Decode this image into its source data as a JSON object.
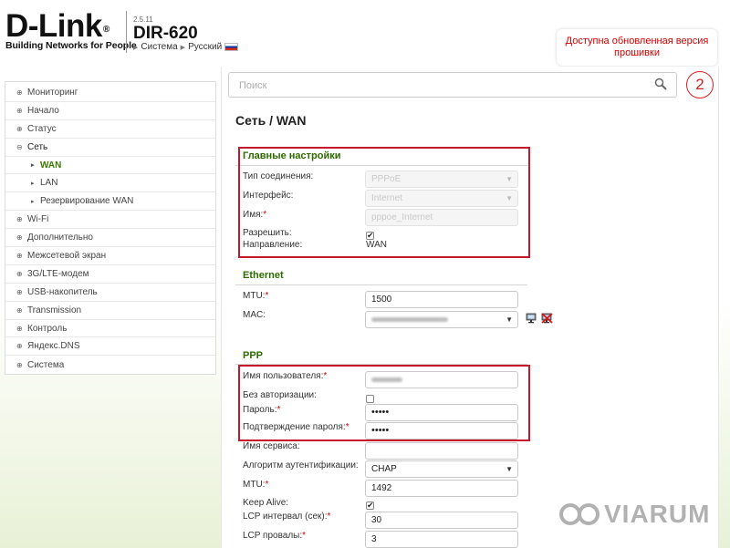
{
  "header": {
    "logo_text": "D-Link",
    "logo_tagline": "Building Networks for People",
    "firmware_version": "2.5.11",
    "model": "DIR-620",
    "breadcrumb": {
      "system": "Система",
      "language": "Русский"
    },
    "update_notice": "Доступна обновленная версия прошивки"
  },
  "search": {
    "placeholder": "Поиск"
  },
  "annotation_badge": "2",
  "sidebar": {
    "items": [
      {
        "label": "Мониторинг"
      },
      {
        "label": "Начало"
      },
      {
        "label": "Статус"
      },
      {
        "label": "Сеть"
      },
      {
        "label": "WAN"
      },
      {
        "label": "LAN"
      },
      {
        "label": "Резервирование WAN"
      },
      {
        "label": "Wi-Fi"
      },
      {
        "label": "Дополнительно"
      },
      {
        "label": "Межсетевой экран"
      },
      {
        "label": "3G/LTE-модем"
      },
      {
        "label": "USB-накопитель"
      },
      {
        "label": "Transmission"
      },
      {
        "label": "Контроль"
      },
      {
        "label": "Яндекс.DNS"
      },
      {
        "label": "Система"
      }
    ]
  },
  "page": {
    "title": "Сеть /  WAN",
    "main_settings": {
      "heading": "Главные настройки",
      "connection_type_label": "Тип соединения:",
      "connection_type_value": "PPPoE",
      "interface_label": "Интерфейс:",
      "interface_value": "Internet",
      "name_label": "Имя:",
      "name_value": "pppoe_Internet",
      "enable_label": "Разрешить:",
      "enable_checked": true,
      "direction_label": "Направление:",
      "direction_value": "WAN"
    },
    "ethernet": {
      "heading": "Ethernet",
      "mtu_label": "MTU:",
      "mtu_value": "1500",
      "mac_label": "MAC:"
    },
    "ppp": {
      "heading": "PPP",
      "username_label": "Имя пользователя:",
      "no_auth_label": "Без авторизации:",
      "no_auth_checked": false,
      "password_label": "Пароль:",
      "password_value": "•••••",
      "password_confirm_label": "Подтверждение пароля:",
      "password_confirm_value": "•••••",
      "service_name_label": "Имя сервиса:",
      "service_name_value": "",
      "auth_algo_label": "Алгоритм аутентификации:",
      "auth_algo_value": "CHAP",
      "mtu_label": "MTU:",
      "mtu_value": "1492",
      "keepalive_label": "Keep Alive:",
      "keepalive_checked": true,
      "lcp_interval_label": "LCP интервал (сек):",
      "lcp_interval_value": "30",
      "lcp_failures_label": "LCP провалы:",
      "lcp_failures_value": "3"
    }
  },
  "watermark": "VIARUM",
  "colors": {
    "accent_green": "#2d6a00",
    "highlight_red": "#c8172b",
    "notice_red": "#d30000"
  }
}
